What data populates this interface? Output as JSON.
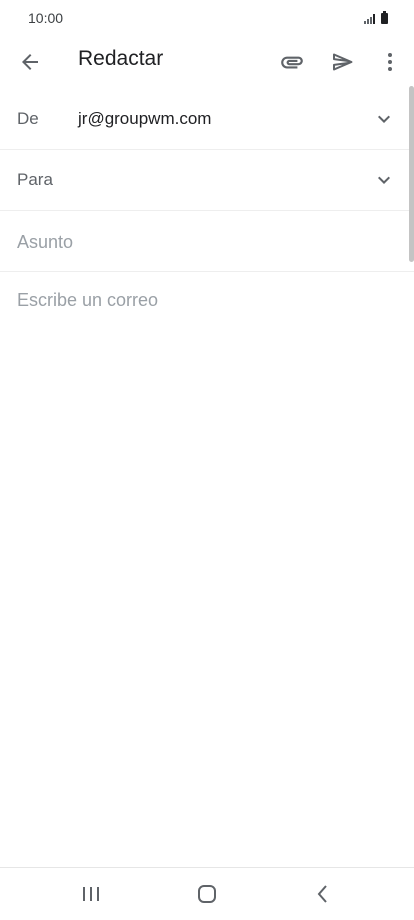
{
  "status_bar": {
    "time": "10:00"
  },
  "toolbar": {
    "title": "Redactar"
  },
  "from": {
    "label": "De",
    "value": "jr@groupwm.com"
  },
  "to": {
    "label": "Para"
  },
  "subject": {
    "placeholder": "Asunto"
  },
  "body": {
    "placeholder": "Escribe un correo"
  }
}
